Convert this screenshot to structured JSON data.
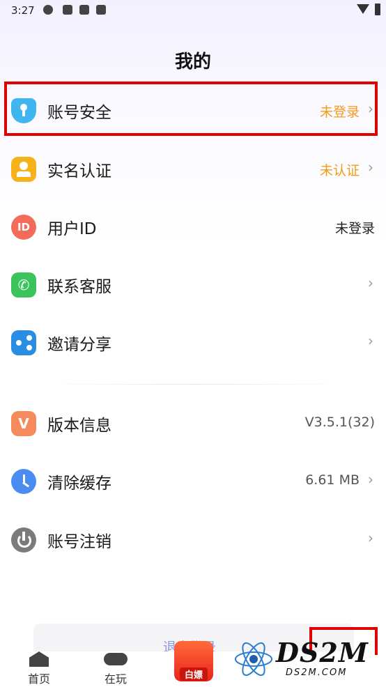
{
  "status_bar": {
    "time": "3:27"
  },
  "page": {
    "title": "我的"
  },
  "menu": [
    {
      "label": "账号安全",
      "value": "未登录",
      "value_color": "#f39a1a",
      "icon": "shield-key-icon"
    },
    {
      "label": "实名认证",
      "value": "未认证",
      "value_color": "#f39a1a",
      "icon": "id-card-icon"
    },
    {
      "label": "用户ID",
      "value": "未登录",
      "icon": "id-icon",
      "icon_text": "ID"
    },
    {
      "label": "联系客服",
      "value": "",
      "icon": "phone-icon"
    },
    {
      "label": "邀请分享",
      "value": "",
      "icon": "share-icon"
    },
    {
      "label": "版本信息",
      "value": "V3.5.1(32)",
      "icon": "version-icon",
      "icon_text": "V"
    },
    {
      "label": "清除缓存",
      "value": "6.61 MB",
      "icon": "clock-icon"
    },
    {
      "label": "账号注销",
      "value": "",
      "icon": "power-icon"
    }
  ],
  "logout": {
    "label": "退出登录"
  },
  "tabs": [
    {
      "label": "首页",
      "icon": "home-icon"
    },
    {
      "label": "在玩",
      "icon": "gamepad-icon"
    }
  ],
  "promo": {
    "label": "白嫖"
  },
  "watermark": {
    "main": "DS2M",
    "sub": "DS2M.COM"
  }
}
